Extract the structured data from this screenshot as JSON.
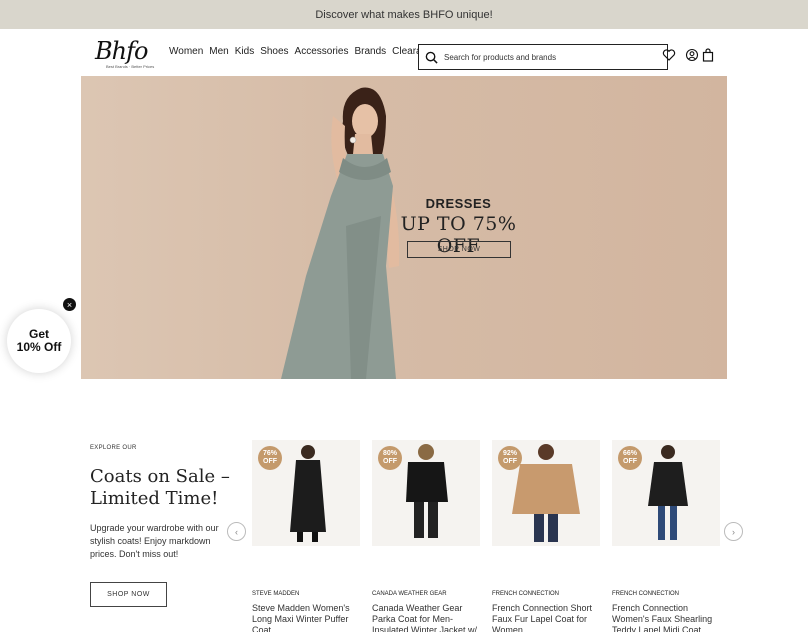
{
  "promo_bar": {
    "text": "Discover what makes BHFO unique!"
  },
  "header": {
    "logo": {
      "main": "Bhfo",
      "sub": "Best Brands · Better Prices"
    },
    "nav": [
      "Women",
      "Men",
      "Kids",
      "Shoes",
      "Accessories",
      "Brands",
      "Clearance"
    ],
    "search": {
      "placeholder": "Search for products and brands",
      "value": ""
    },
    "icons": [
      "heart-icon",
      "account-icon",
      "bag-icon"
    ]
  },
  "hero": {
    "title": "DRESSES",
    "subtitle": "UP TO 75% OFF",
    "button_label": "SHOP NOW",
    "colors": {
      "background": "#d6bca7",
      "dress": "#8e9b94"
    }
  },
  "popup": {
    "line1": "Get",
    "line2": "10% Off",
    "close": "×"
  },
  "coats_promo": {
    "eyebrow": "EXPLORE OUR",
    "title": "Coats on Sale – Limited Time!",
    "description": "Upgrade your wardrobe with our stylish coats! Enjoy markdown prices. Don't miss out!",
    "button_label": "SHOP NOW"
  },
  "carousel": {
    "prev": "‹",
    "next": "›",
    "products": [
      {
        "discount": "76%",
        "off": "OFF",
        "brand": "STEVE MADDEN",
        "name": "Steve Madden Women's Long Maxi Winter Puffer Coat",
        "coat_color": "#1c1c1c"
      },
      {
        "discount": "80%",
        "off": "OFF",
        "brand": "CANADA WEATHER GEAR",
        "name": "Canada Weather Gear Parka Coat for Men- Insulated Winter Jacket w/",
        "coat_color": "#161616"
      },
      {
        "discount": "92%",
        "off": "OFF",
        "brand": "FRENCH CONNECTION",
        "name": "French Connection Short Faux Fur Lapel Coat for Women",
        "coat_color": "#c89a6e"
      },
      {
        "discount": "66%",
        "off": "OFF",
        "brand": "FRENCH CONNECTION",
        "name": "French Connection Women's Faux Shearling Teddy Lapel Midi Coat",
        "coat_color": "#1e1e1e"
      }
    ]
  },
  "colors": {
    "accent_badge": "#c49a6c",
    "promo_bar": "#d9d6cc"
  }
}
